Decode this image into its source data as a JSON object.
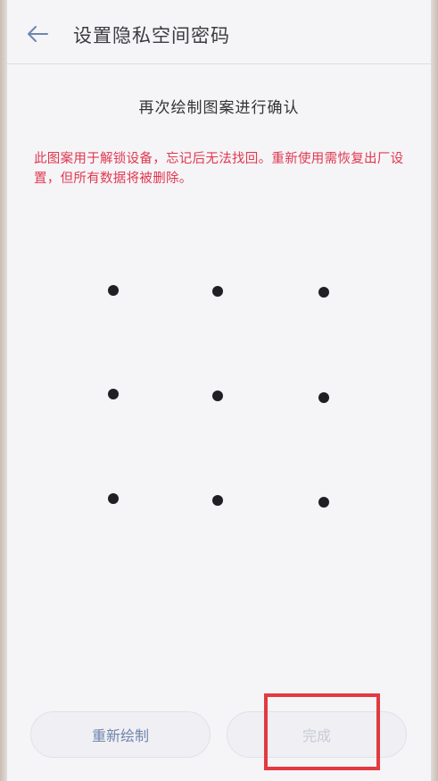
{
  "header": {
    "back_icon": "arrow-left-icon",
    "title": "设置隐私空间密码"
  },
  "main": {
    "instruction": "再次绘制图案进行确认",
    "warning": "此图案用于解锁设备，忘记后无法找回。重新使用需恢复出厂设置，但所有数据将被删除。"
  },
  "pattern": {
    "rows": 3,
    "cols": 3
  },
  "footer": {
    "redraw_label": "重新绘制",
    "done_label": "完成"
  },
  "colors": {
    "warning": "#e0394f",
    "redraw_text": "#6e86ad",
    "done_text_disabled": "#c7cbd6",
    "highlight": "#e23a3f"
  }
}
